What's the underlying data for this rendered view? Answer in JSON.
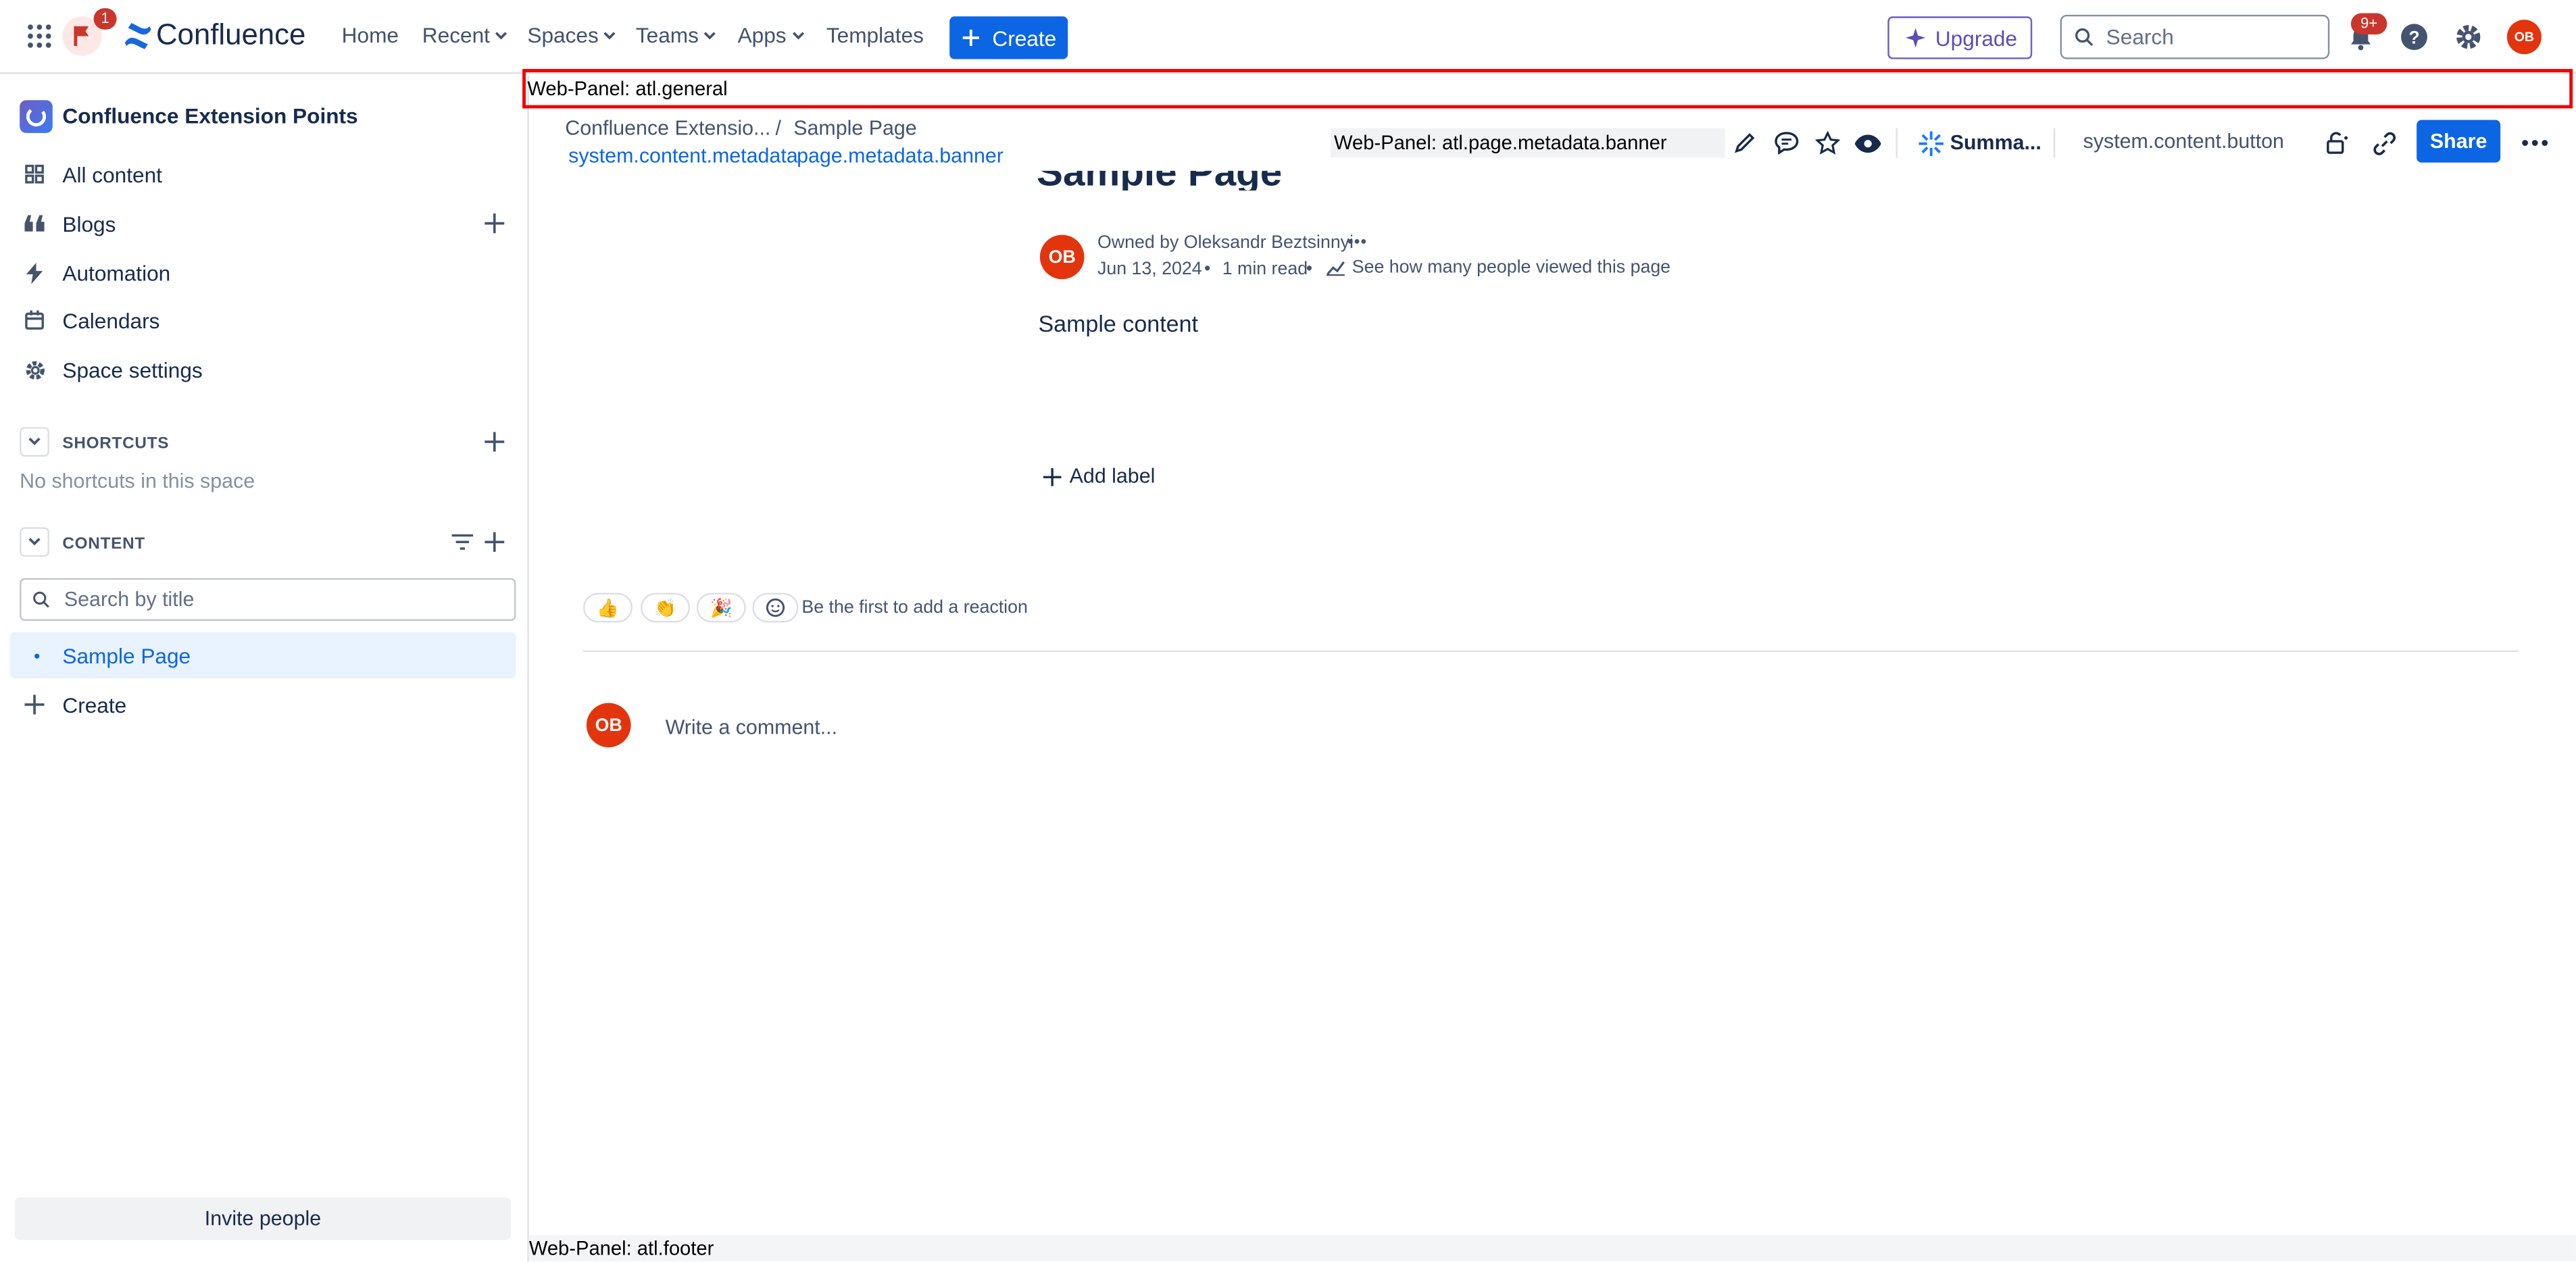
{
  "topbar": {
    "notification_count": "1",
    "brand": "Confluence",
    "nav": {
      "home": "Home",
      "recent": "Recent",
      "spaces": "Spaces",
      "teams": "Teams",
      "apps": "Apps",
      "templates": "Templates"
    },
    "create_label": "Create",
    "upgrade_label": "Upgrade",
    "search_placeholder": "Search",
    "updates_badge": "9+",
    "user_initials": "OB"
  },
  "sidebar": {
    "space_name": "Confluence Extension Points",
    "items": [
      {
        "label": "All content",
        "icon": "all-content-icon"
      },
      {
        "label": "Blogs",
        "icon": "quote-icon"
      },
      {
        "label": "Automation",
        "icon": "lightning-icon"
      },
      {
        "label": "Calendars",
        "icon": "calendar-icon"
      },
      {
        "label": "Space settings",
        "icon": "gear-icon"
      }
    ],
    "shortcuts_heading": "SHORTCUTS",
    "shortcuts_empty": "No shortcuts in this space",
    "content_heading": "CONTENT",
    "search_placeholder": "Search by title",
    "tree": [
      {
        "label": "Sample Page"
      }
    ],
    "create_label": "Create",
    "invite_label": "Invite people"
  },
  "panels": {
    "general": "Web-Panel: atl.general",
    "metadata_banner": "Web-Panel: atl.page.metadata.banner",
    "footer": "Web-Panel: atl.footer"
  },
  "breadcrumb": {
    "space": "Confluence Extensio...",
    "separator": "/",
    "page": "Sample Page"
  },
  "metadata_links": {
    "content_metadata": "system.content.metadata",
    "page_metadata_banner": "page.metadata.banner"
  },
  "toolbar": {
    "summarize_label": "Summa...",
    "content_button": "system.content.button",
    "share_label": "Share"
  },
  "page": {
    "title": "Sample Page",
    "owner_text": "Owned by Oleksandr Beztsinnyi",
    "date": "Jun 13, 2024",
    "read_time": "1 min read",
    "views_link": "See how many people viewed this page",
    "body": "Sample content",
    "add_label": "Add label",
    "owner_initials": "OB"
  },
  "reactions": {
    "items": [
      "👍",
      "👏",
      "🎉"
    ],
    "prompt": "Be the first to add a reaction"
  },
  "comment": {
    "initials": "OB",
    "placeholder": "Write a comment..."
  },
  "colors": {
    "primary": "#0c66e4",
    "avatar": "#e2350e",
    "panel_border": "#ee0000",
    "badge": "#c9372c"
  }
}
